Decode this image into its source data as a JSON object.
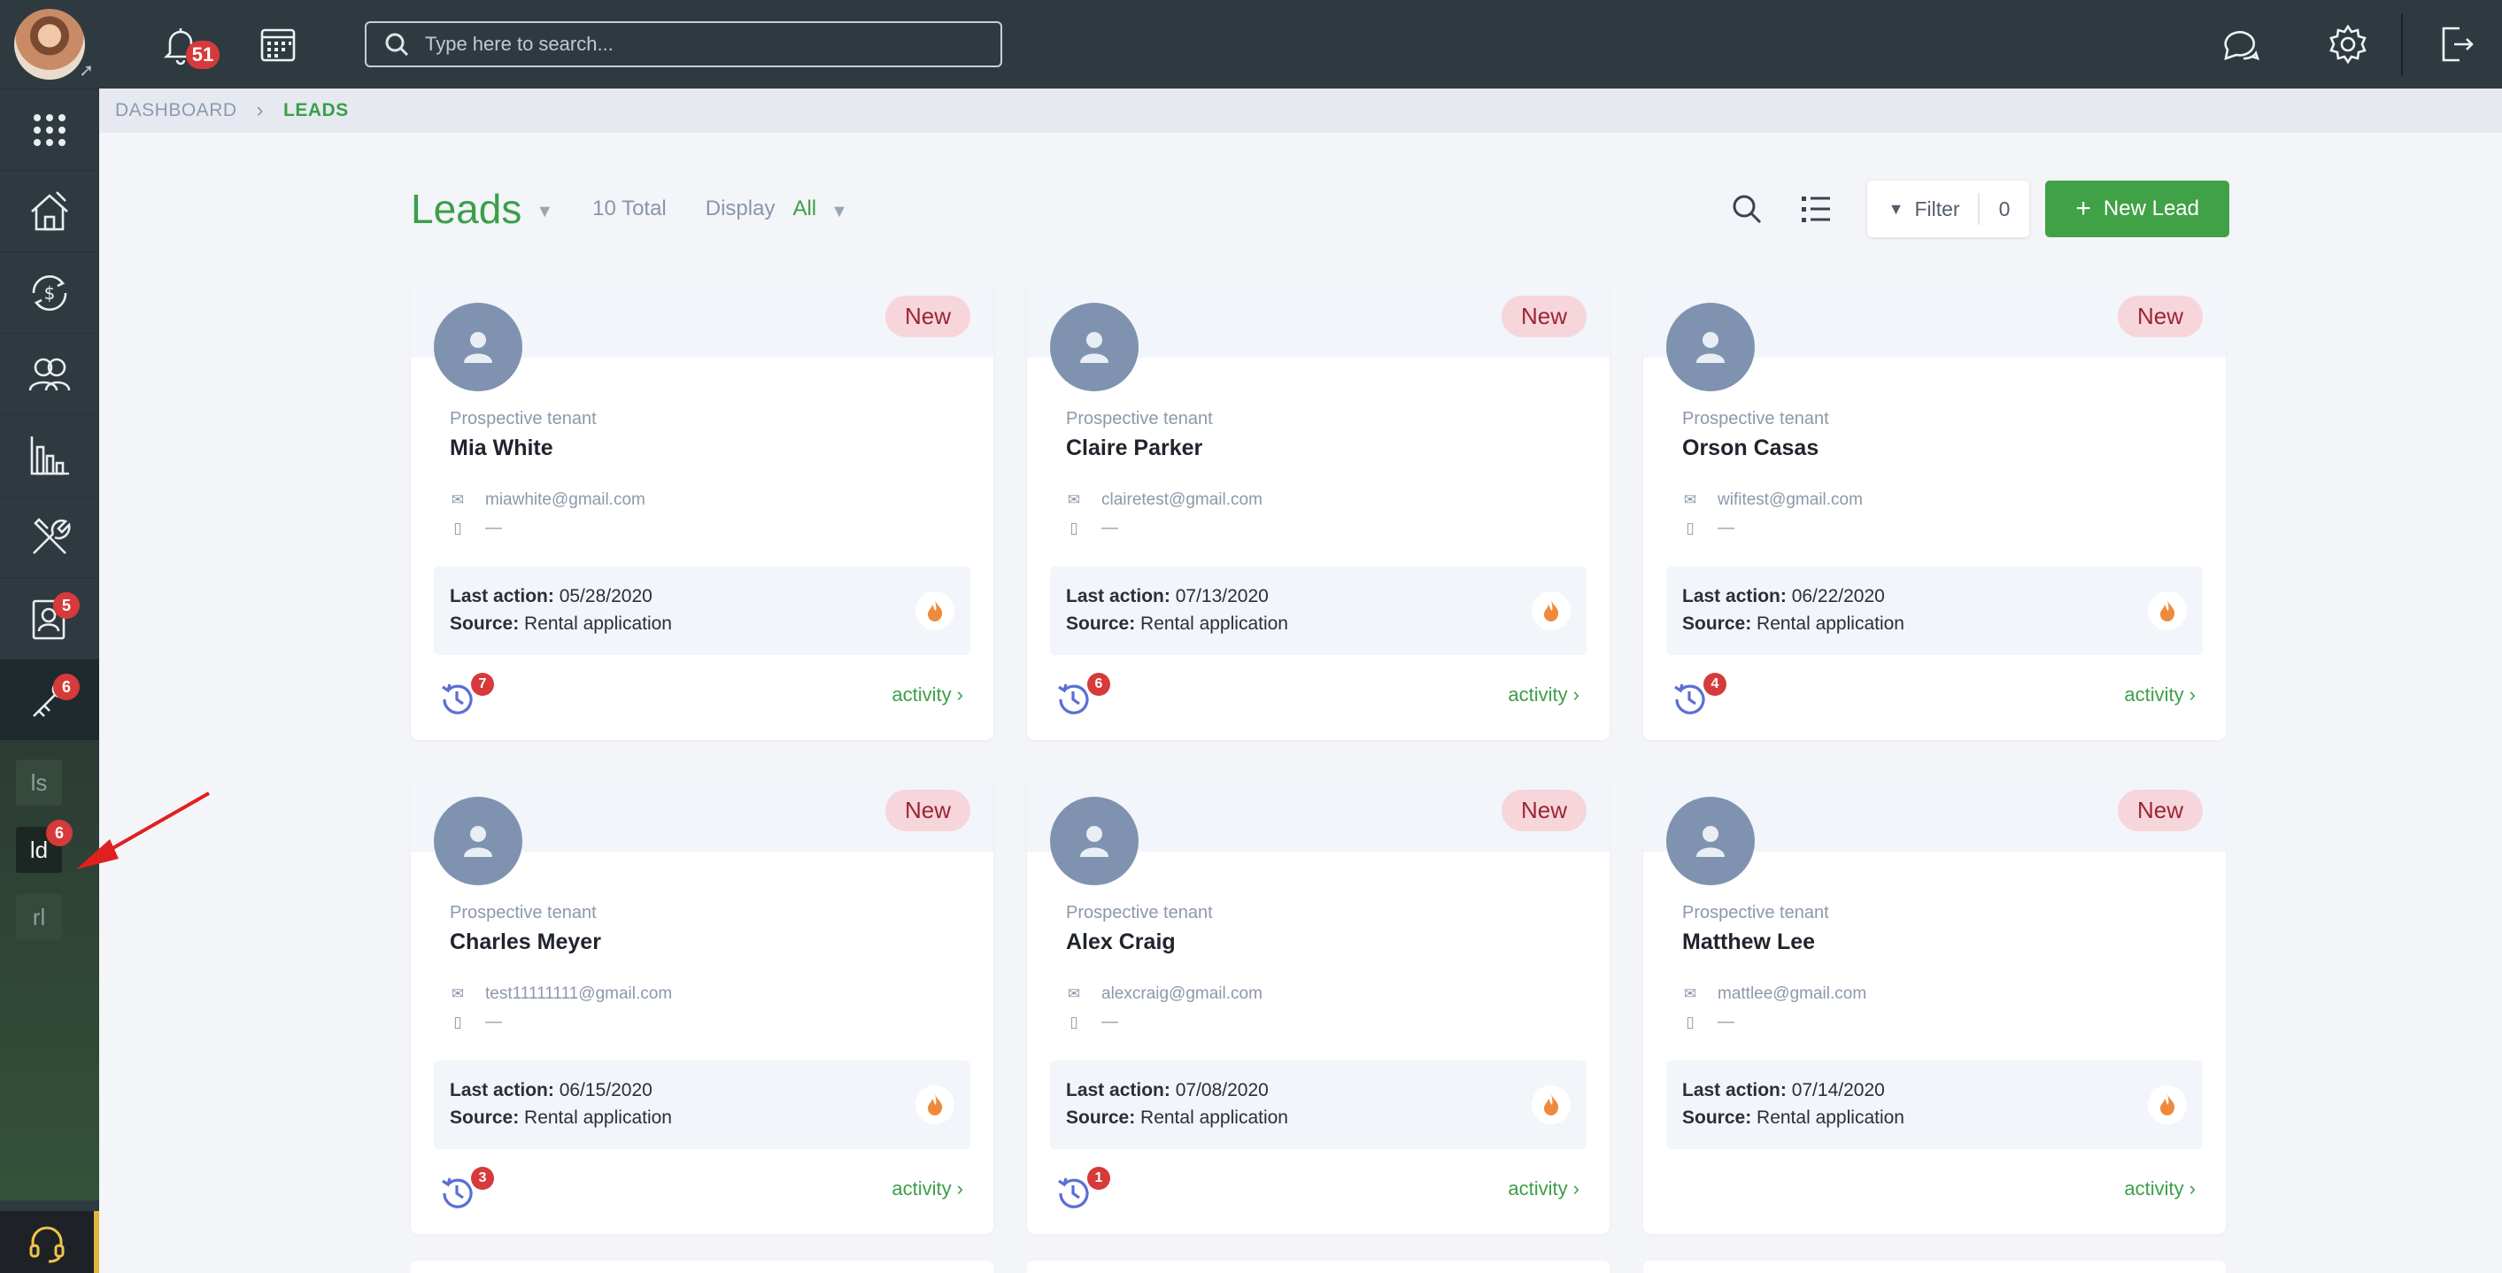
{
  "top": {
    "notification_count": "51",
    "search_placeholder": "Type here to search..."
  },
  "sidebar": {
    "items": [
      {
        "icon": "apps-grid-icon",
        "badge": null
      },
      {
        "icon": "house-icon",
        "badge": null
      },
      {
        "icon": "money-cycle-icon",
        "badge": null
      },
      {
        "icon": "people-icon",
        "badge": null
      },
      {
        "icon": "bar-chart-icon",
        "badge": null
      },
      {
        "icon": "tools-icon",
        "badge": null
      },
      {
        "icon": "contact-card-icon",
        "badge": "5"
      },
      {
        "icon": "key-icon",
        "badge": "6"
      }
    ],
    "sub_items": [
      {
        "label": "ls",
        "badge": null
      },
      {
        "label": "ld",
        "badge": "6"
      },
      {
        "label": "rl",
        "badge": null
      }
    ]
  },
  "breadcrumb": {
    "dashboard": "DASHBOARD",
    "current": "LEADS"
  },
  "header": {
    "title": "Leads",
    "total": "10 Total",
    "display_label": "Display",
    "display_value": "All",
    "filter_label": "Filter",
    "filter_count": "0",
    "new_button": "New Lead"
  },
  "cards": [
    {
      "status": "New",
      "subtitle": "Prospective tenant",
      "name": "Mia White",
      "email": "miawhite@gmail.com",
      "phone": "—",
      "last_action_label": "Last action:",
      "last_action": "05/28/2020",
      "source_label": "Source:",
      "source": "Rental application",
      "activity_count": "7",
      "activity_link": "activity"
    },
    {
      "status": "New",
      "subtitle": "Prospective tenant",
      "name": "Claire Parker",
      "email": "clairetest@gmail.com",
      "phone": "—",
      "last_action_label": "Last action:",
      "last_action": "07/13/2020",
      "source_label": "Source:",
      "source": "Rental application",
      "activity_count": "6",
      "activity_link": "activity"
    },
    {
      "status": "New",
      "subtitle": "Prospective tenant",
      "name": "Orson Casas",
      "email": "wifitest@gmail.com",
      "phone": "—",
      "last_action_label": "Last action:",
      "last_action": "06/22/2020",
      "source_label": "Source:",
      "source": "Rental application",
      "activity_count": "4",
      "activity_link": "activity"
    },
    {
      "status": "New",
      "subtitle": "Prospective tenant",
      "name": "Charles Meyer",
      "email": "test11111111@gmail.com",
      "phone": "—",
      "last_action_label": "Last action:",
      "last_action": "06/15/2020",
      "source_label": "Source:",
      "source": "Rental application",
      "activity_count": "3",
      "activity_link": "activity"
    },
    {
      "status": "New",
      "subtitle": "Prospective tenant",
      "name": "Alex Craig",
      "email": "alexcraig@gmail.com",
      "phone": "—",
      "last_action_label": "Last action:",
      "last_action": "07/08/2020",
      "source_label": "Source:",
      "source": "Rental application",
      "activity_count": "1",
      "activity_link": "activity"
    },
    {
      "status": "New",
      "subtitle": "Prospective tenant",
      "name": "Matthew Lee",
      "email": "mattlee@gmail.com",
      "phone": "—",
      "last_action_label": "Last action:",
      "last_action": "07/14/2020",
      "source_label": "Source:",
      "source": "Rental application",
      "activity_count": null,
      "activity_link": "activity"
    }
  ],
  "colors": {
    "accent_green": "#41a147",
    "sidebar": "#2f3a40",
    "badge_red": "#d63a3a",
    "new_badge_bg": "#f6d6db",
    "new_badge_text": "#9c2436",
    "annotation_arrow": "#e02020"
  }
}
